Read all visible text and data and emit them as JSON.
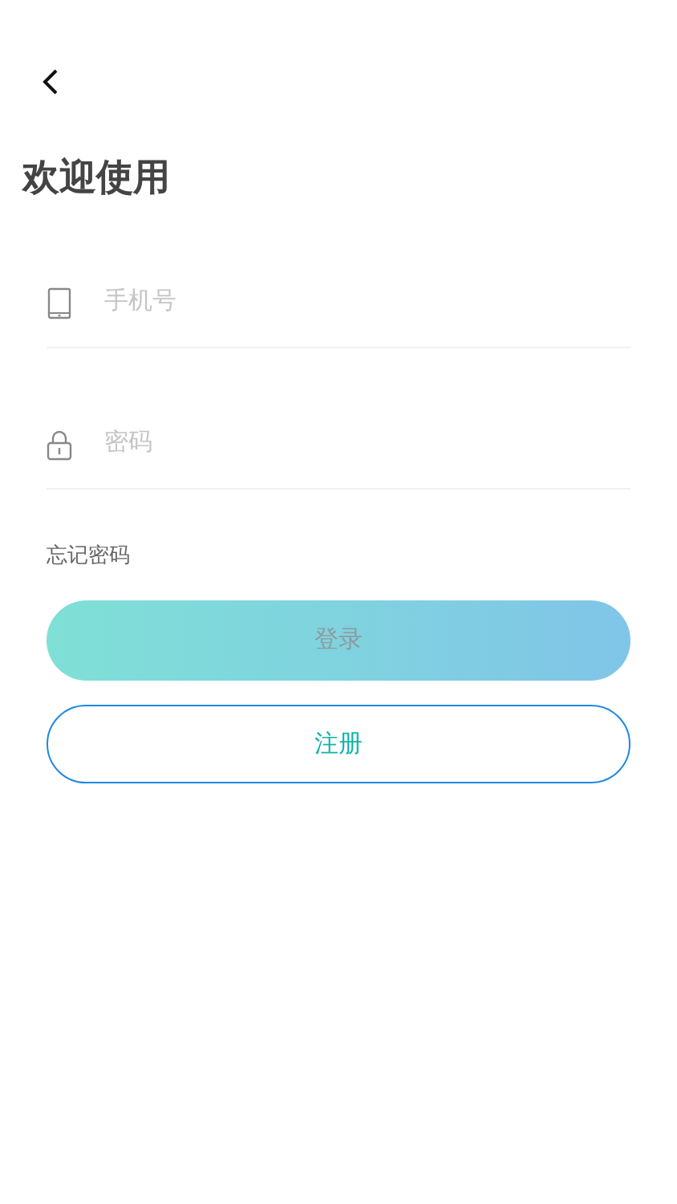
{
  "title": "欢迎使用",
  "fields": [
    {
      "kind": "phone",
      "placeholder": "手机号"
    },
    {
      "kind": "password",
      "placeholder": "密码"
    }
  ],
  "forgot_link": "忘记密码",
  "login_button": {
    "label": "登录",
    "disabled": true
  },
  "register_button": {
    "label": "注册"
  }
}
